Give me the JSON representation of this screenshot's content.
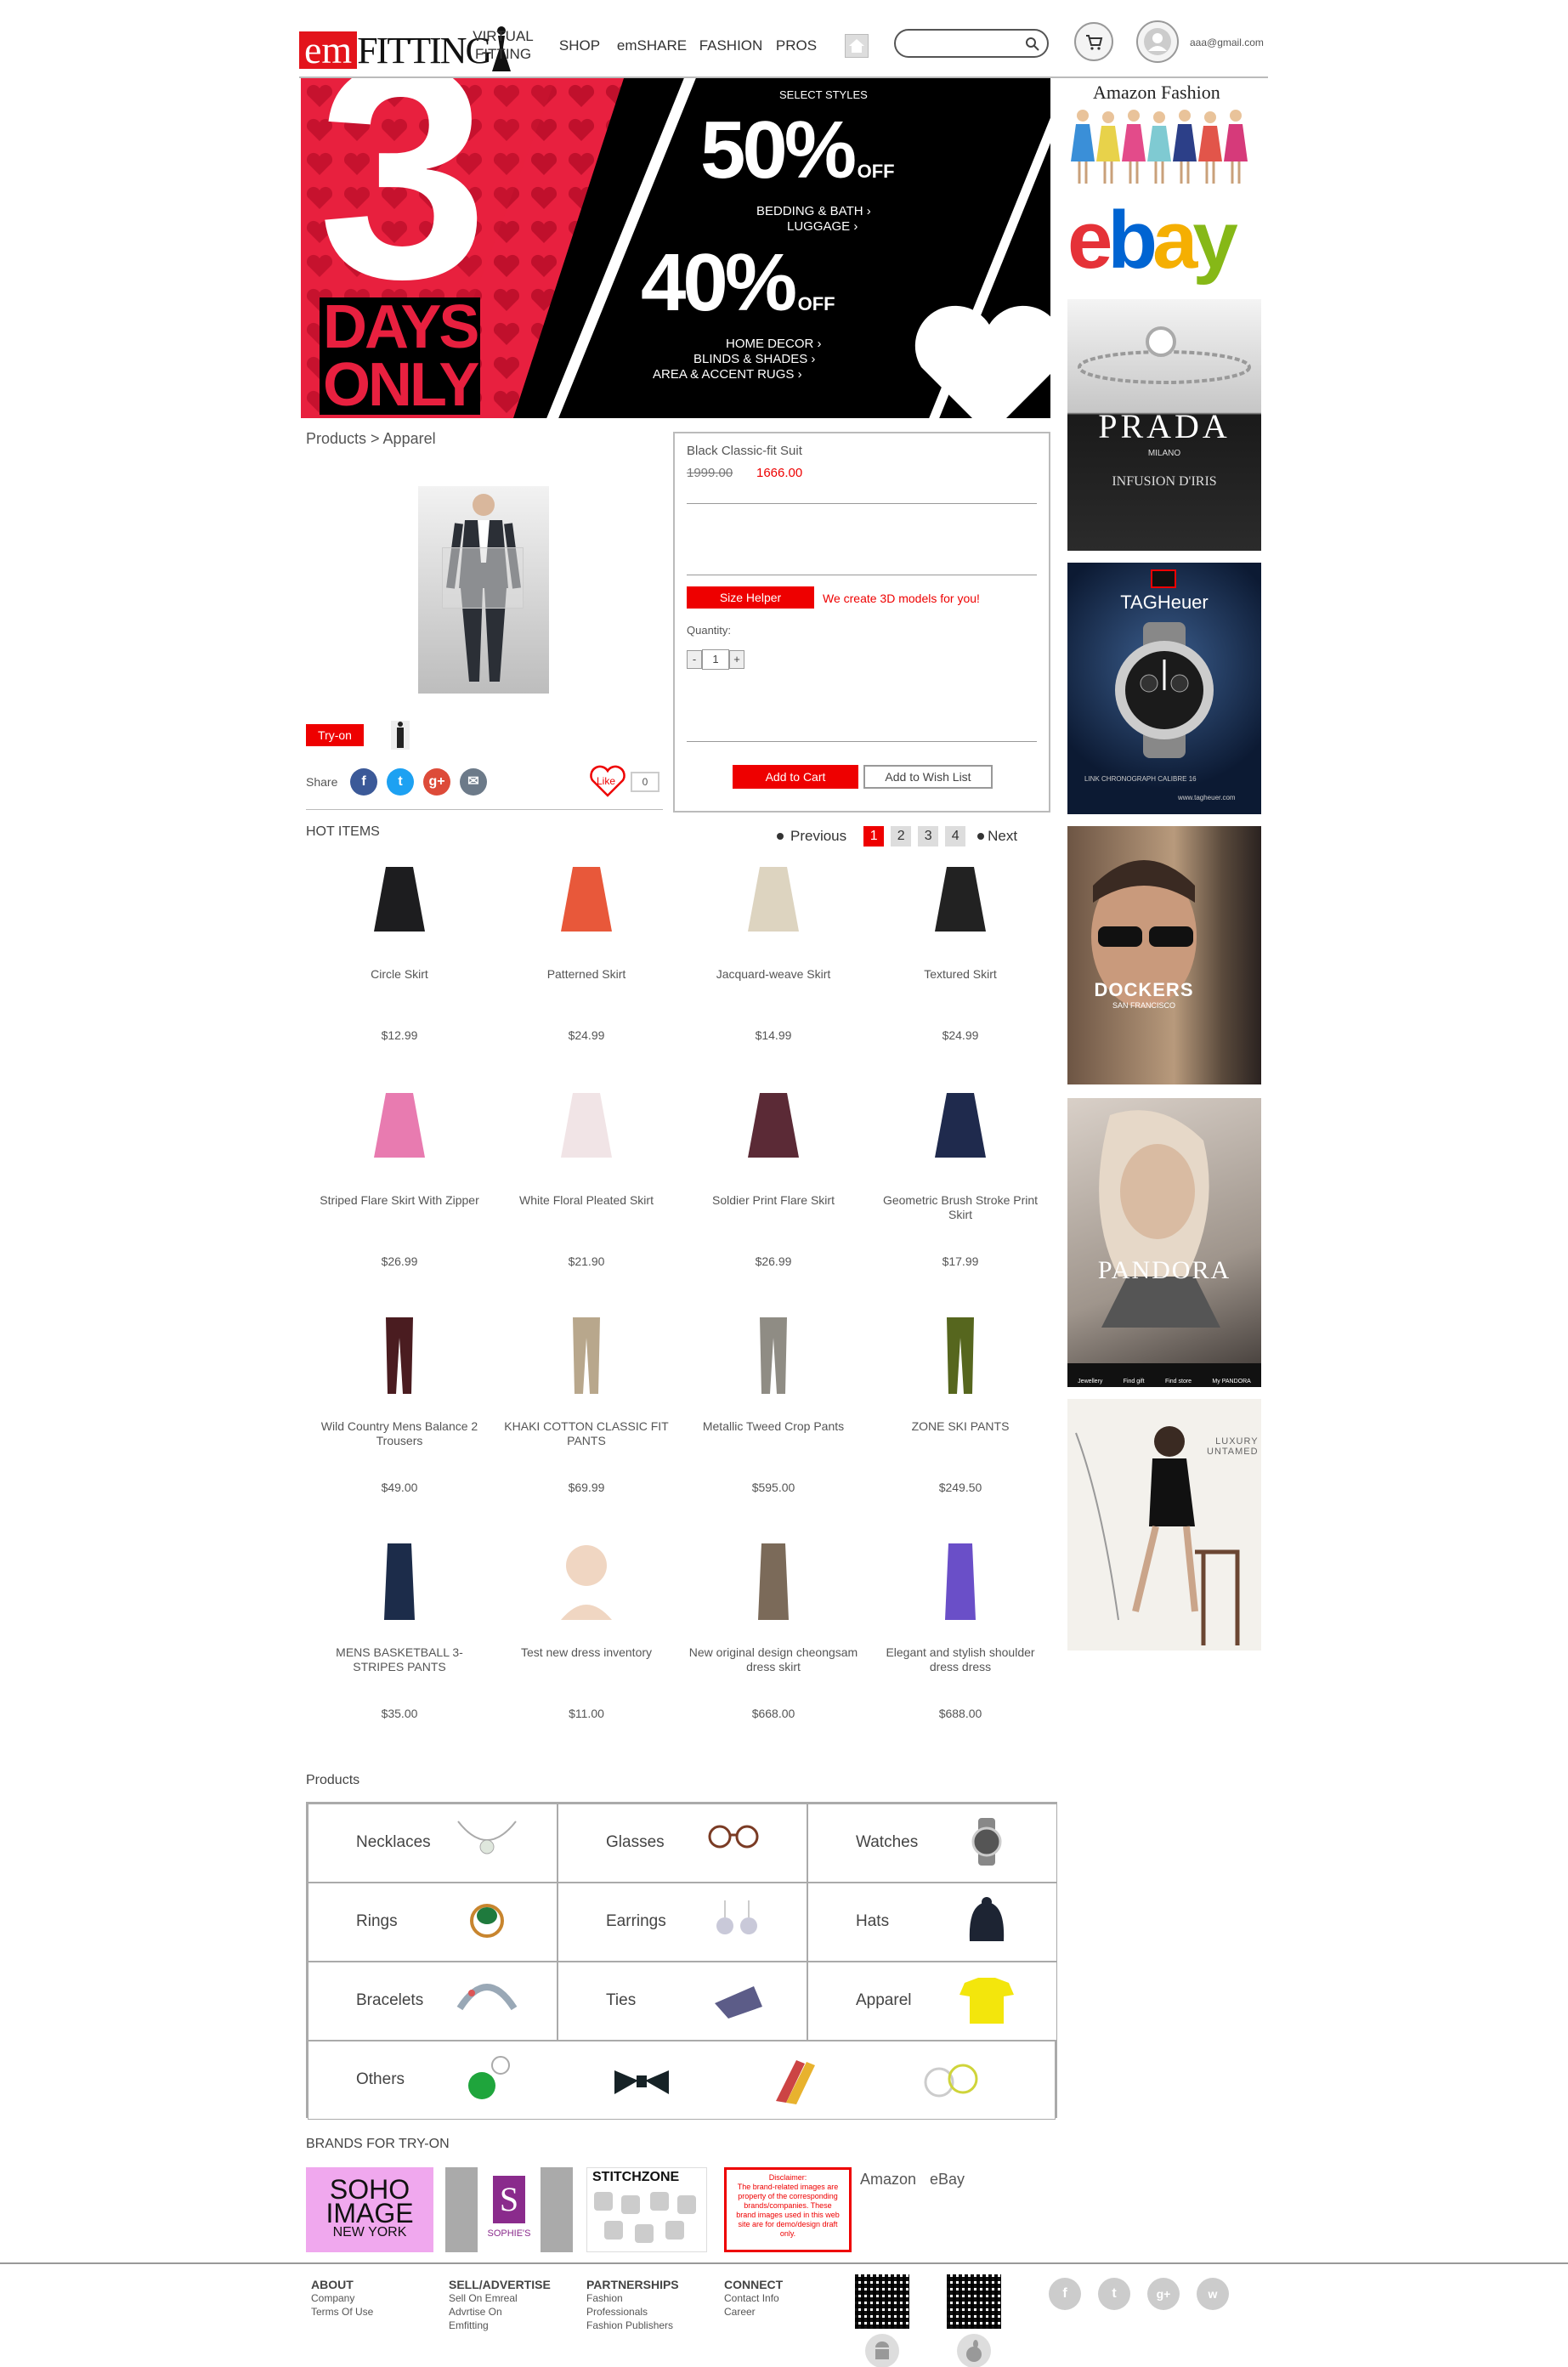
{
  "header": {
    "logo_em": "em",
    "logo_fitting": "FITTING",
    "nav": [
      "VIRTUAL\nFITTING",
      "SHOP",
      "emSHARE",
      "FASHION",
      "PROS"
    ],
    "search_placeholder": "",
    "user_email": "aaa@gmail.com"
  },
  "banner": {
    "big_number": "3",
    "days_only_1": "DAYS",
    "days_only_2": "ONLY",
    "select_styles": "SELECT STYLES",
    "offer1": "50%",
    "offer1_off": "OFF",
    "offer1_items": [
      "BEDDING & BATH ›",
      "LUGGAGE ›"
    ],
    "offer2": "40%",
    "offer2_off": "OFF",
    "offer2_items": [
      "HOME DECOR ›",
      "BLINDS & SHADES ›",
      "AREA & ACCENT RUGS ›"
    ]
  },
  "breadcrumb": "Products > Apparel",
  "product": {
    "title": "Black Classic-fit Suit",
    "old_price": "1999.00",
    "price": "1666.00",
    "size_helper": "Size Helper",
    "size_note": "We create 3D models for you!",
    "quantity_label": "Quantity:",
    "quantity_value": "1",
    "minus": "-",
    "plus": "+",
    "add_to_cart": "Add to Cart",
    "add_to_wishlist": "Add to Wish List",
    "tryon": "Try-on",
    "share_label": "Share",
    "like_label": "Like",
    "like_count": "0"
  },
  "hot_items": {
    "title": "HOT ITEMS",
    "previous": "Previous",
    "next": "Next",
    "pages": [
      "1",
      "2",
      "3",
      "4"
    ],
    "items": [
      {
        "name": "Circle Skirt",
        "price": "$12.99"
      },
      {
        "name": "Patterned Skirt",
        "price": "$24.99"
      },
      {
        "name": "Jacquard-weave Skirt",
        "price": "$14.99"
      },
      {
        "name": "Textured Skirt",
        "price": "$24.99"
      },
      {
        "name": "Striped Flare Skirt With Zipper",
        "price": "$26.99"
      },
      {
        "name": "White Floral Pleated Skirt",
        "price": "$21.90"
      },
      {
        "name": "Soldier Print Flare Skirt",
        "price": "$26.99"
      },
      {
        "name": "Geometric Brush Stroke Print Skirt",
        "price": "$17.99"
      },
      {
        "name": "Wild Country Mens Balance 2 Trousers",
        "price": "$49.00"
      },
      {
        "name": "KHAKI COTTON CLASSIC FIT PANTS",
        "price": "$69.99"
      },
      {
        "name": "Metallic Tweed Crop Pants",
        "price": "$595.00"
      },
      {
        "name": "ZONE SKI PANTS",
        "price": "$249.50"
      },
      {
        "name": "MENS BASKETBALL 3-STRIPES PANTS",
        "price": "$35.00"
      },
      {
        "name": "Test new dress inventory",
        "price": "$11.00"
      },
      {
        "name": "New original design cheongsam dress skirt",
        "price": "$668.00"
      },
      {
        "name": "Elegant and stylish shoulder dress dress",
        "price": "$688.00"
      }
    ]
  },
  "products": {
    "title": "Products",
    "categories": [
      "Necklaces",
      "Glasses",
      "Watches",
      "Rings",
      "Earrings",
      "Hats",
      "Bracelets",
      "Ties",
      "Apparel",
      "Others"
    ]
  },
  "brands": {
    "title": "BRANDS FOR TRY-ON",
    "soho": [
      "SOHO",
      "IMAGE",
      "NEW YORK"
    ],
    "sophies": "SOPHIE'S",
    "stitchzone": "STITCHZONE",
    "disclaimer": "Disclaimer:\nThe brand-related images are property of the corresponding brands/companies. These brand images used in this web site are for demo/design draft only.",
    "amazon": "Amazon",
    "ebay": "eBay"
  },
  "ads": {
    "amazon_fashion": "Amazon Fashion",
    "ebay_e": "e",
    "ebay_b": "b",
    "ebay_a": "a",
    "ebay_y": "y",
    "prada": "PRADA",
    "prada_sub": "MILANO",
    "prada_sub2": "INFUSION D'IRIS",
    "tagheuer": "TAGHeuer",
    "tag_caption": "LINK CHRONOGRAPH CALIBRE 16",
    "tag_url": "www.tagheuer.com",
    "dockers": "DOCKERS",
    "dockers_sub": "SAN FRANCISCO",
    "pandora": "PANDORA",
    "pandora_menu": [
      "Jewellery",
      "Find gift",
      "Find store",
      "My PANDORA"
    ],
    "luxury": "LUXURY\nUNTAMED"
  },
  "footer": {
    "cols": [
      {
        "title": "ABOUT",
        "links": [
          "Company",
          "Terms Of Use"
        ]
      },
      {
        "title": "SELL/ADVERTISE",
        "links": [
          "Sell On Emreal",
          "Advrtise On",
          "Emfitting"
        ]
      },
      {
        "title": "PARTNERSHIPS",
        "links": [
          "Fashion",
          "Professionals",
          "Fashion Publishers"
        ]
      },
      {
        "title": "CONNECT",
        "links": [
          "Contact Info",
          "Career"
        ]
      }
    ],
    "social": [
      "f",
      "t",
      "g+",
      "w"
    ]
  },
  "colors": {
    "accent": "#e3141b",
    "banner_pink": "#e8203f",
    "text": "#444444"
  }
}
